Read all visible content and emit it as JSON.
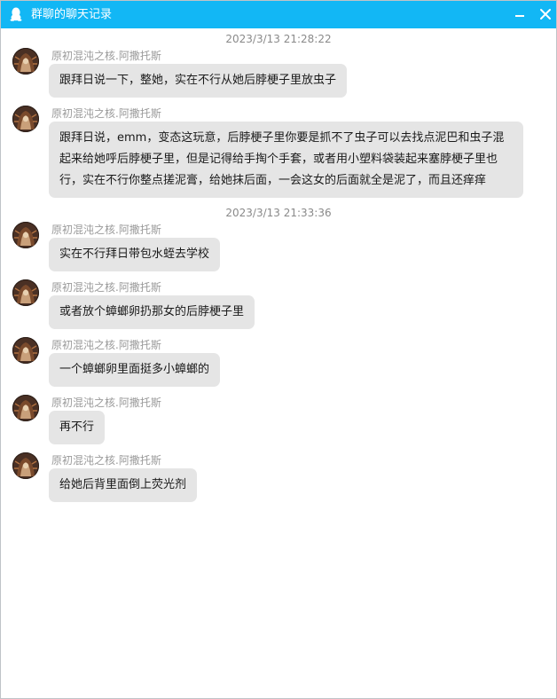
{
  "window": {
    "title": "群聊的聊天记录"
  },
  "timestamps": [
    "2023/3/13 21:28:22",
    "2023/3/13 21:33:36"
  ],
  "sender_name": "原初混沌之核.阿撒托斯",
  "messages": [
    {
      "text": "跟拜日说一下，整她，实在不行从她后脖梗子里放虫子"
    },
    {
      "text": "跟拜日说，emm，变态这玩意，后脖梗子里你要是抓不了虫子可以去找点泥巴和虫子混起来给她呼后脖梗子里，但是记得给手掏个手套，或者用小塑料袋装起来塞脖梗子里也行，实在不行你整点搓泥膏，给她抹后面，一会这女的后面就全是泥了，而且还痒痒"
    },
    {
      "text": "实在不行拜日带包水蛭去学校"
    },
    {
      "text": "或者放个蟑螂卵扔那女的后脖梗子里"
    },
    {
      "text": "一个蟑螂卵里面挺多小蟑螂的"
    },
    {
      "text": "再不行"
    },
    {
      "text": "给她后背里面倒上荧光剂"
    }
  ],
  "icons": {
    "app": "qq-penguin-icon",
    "minimize": "minimize-icon",
    "close": "close-icon"
  },
  "colors": {
    "titlebar": "#12b7f5",
    "bubble": "#e5e5e5"
  }
}
